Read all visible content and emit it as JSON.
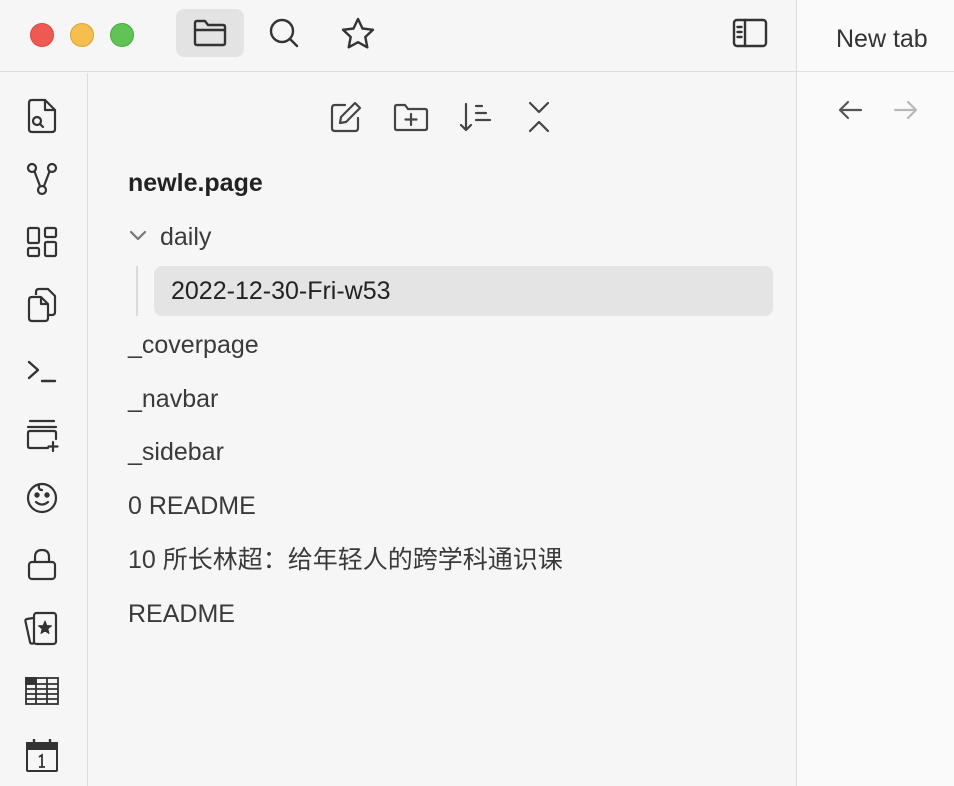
{
  "right_pane": {
    "tab_title": "New tab"
  },
  "explorer": {
    "vault_name": "newle.page",
    "folder": {
      "label": "daily",
      "expanded": true,
      "children": [
        "2022-12-30-Fri-w53"
      ]
    },
    "files": [
      "_coverpage",
      "_navbar",
      "_sidebar",
      "0 README",
      "10 所长林超：给年轻人的跨学科通识课",
      "README"
    ]
  },
  "icons": {
    "titlebar": [
      "folder-icon",
      "search-icon",
      "star-icon",
      "sidebar-toggle-icon"
    ],
    "explorer_toolbar": [
      "new-note-icon",
      "new-folder-icon",
      "sort-icon",
      "collapse-all-icon"
    ],
    "ribbon": [
      "search-file-icon",
      "graph-icon",
      "canvas-icon",
      "copy-icon",
      "terminal-icon",
      "slides-icon",
      "emoji-icon",
      "lock-icon",
      "cards-icon",
      "table-icon",
      "calendar-icon"
    ]
  },
  "colors": {
    "close": "#ee5a52",
    "minimize": "#f5be4f",
    "maximize": "#5fc454",
    "selected_row": "#e4e4e4"
  }
}
